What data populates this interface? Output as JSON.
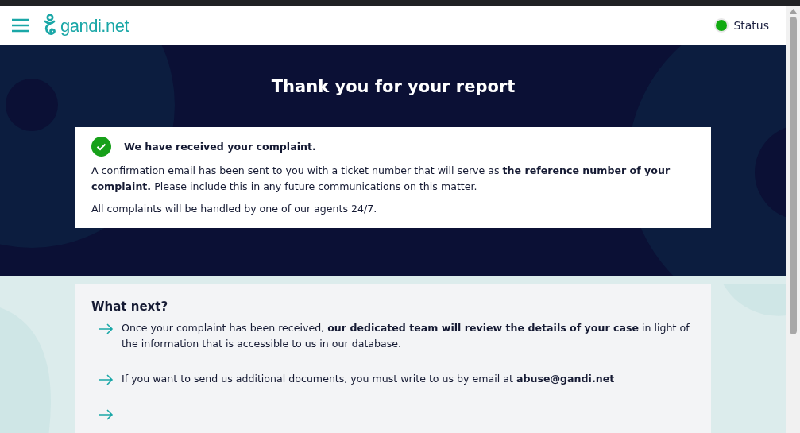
{
  "header": {
    "logo": "gandi.net",
    "status": {
      "label": "Status",
      "color": "#11aa11"
    }
  },
  "hero": {
    "title": "Thank you for your report"
  },
  "confirmation": {
    "heading": "We have received your complaint.",
    "paragraphs": [
      "A confirmation email has been sent to you with a ticket number that will serve as **the reference number of your complaint.** Please include this in any future communications on this matter.",
      "All complaints will be handled by one of our agents 24/7."
    ]
  },
  "next": {
    "heading": "What next?",
    "items": [
      "Once your complaint has been received, **our dedicated team will review the details of your case** in light of the information that is accessible to us in our database.",
      "If you want to send us additional documents, you must write to us by email at **abuse@gandi.net**"
    ]
  }
}
